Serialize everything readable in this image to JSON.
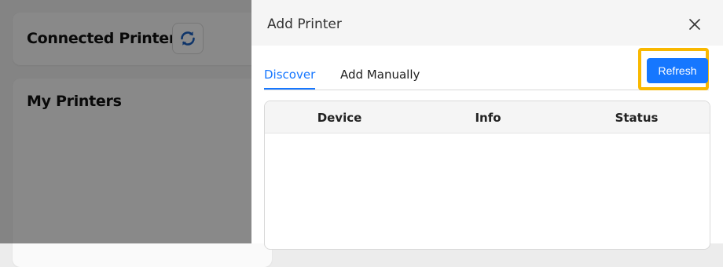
{
  "background": {
    "connected_title": "Connected Printers",
    "my_printers_title": "My Printers"
  },
  "drawer": {
    "title": "Add Printer",
    "tabs": [
      {
        "label": "Discover",
        "active": true
      },
      {
        "label": "Add Manually",
        "active": false
      }
    ],
    "refresh_label": "Refresh",
    "table": {
      "columns": [
        "Device",
        "Info",
        "Status"
      ],
      "rows": []
    }
  },
  "colors": {
    "accent": "#1677ff",
    "highlight": "#f9b800",
    "sync_icon": "#1b5fbf"
  },
  "icons": {
    "sync": "sync-icon",
    "close": "close-icon"
  }
}
